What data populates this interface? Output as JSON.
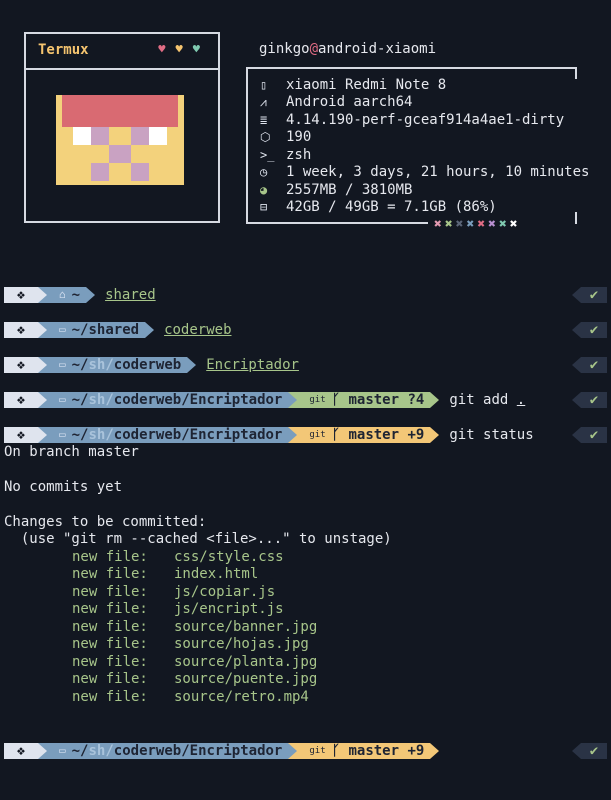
{
  "fetch": {
    "title": "Termux",
    "hearts": [
      "♥",
      "♥",
      "♥"
    ],
    "user": "ginkgo",
    "at": "@",
    "host": "android-xiaomi",
    "rows": [
      {
        "icon": "phone-icon",
        "glyph": "▯",
        "text": "xiaomi Redmi Note 8"
      },
      {
        "icon": "android-icon",
        "glyph": "⩘",
        "text": "Android aarch64"
      },
      {
        "icon": "kernel-icon",
        "glyph": "≣",
        "text": "4.14.190-perf-gceaf914a4ae1-dirty"
      },
      {
        "icon": "package-icon",
        "glyph": "⬡",
        "text": "190"
      },
      {
        "icon": "shell-icon",
        "glyph": ">_",
        "text": "zsh"
      },
      {
        "icon": "clock-icon",
        "glyph": "◷",
        "text": "1 week, 3 days, 21 hours, 10 minutes"
      },
      {
        "icon": "memory-icon",
        "glyph": "◕",
        "text": "2557MB / 3810MB"
      },
      {
        "icon": "disk-icon",
        "glyph": "⊟",
        "text": "42GB / 49GB = 7.1GB (86%)"
      }
    ],
    "palette": [
      {
        "ch": "✖",
        "color": "#e39ab1"
      },
      {
        "ch": "✖",
        "color": "#a7c58a"
      },
      {
        "ch": "✖",
        "color": "#5a6477"
      },
      {
        "ch": "✖",
        "color": "#7a9dbd"
      },
      {
        "ch": "✖",
        "color": "#e06c84"
      },
      {
        "ch": "✖",
        "color": "#b88fd0"
      },
      {
        "ch": "✖",
        "color": "#7fc9b0"
      },
      {
        "ch": "✖",
        "color": "#ffffff"
      }
    ]
  },
  "prompts": [
    {
      "path_pre": "~",
      "path_dim": "",
      "path_bold": "",
      "home_icon": "⌂",
      "git": null,
      "command": "shared",
      "command_style": "underline-green"
    },
    {
      "path_pre": "~/",
      "path_dim": "",
      "path_bold": "shared",
      "home_icon": "▭",
      "git": null,
      "command": "coderweb",
      "command_style": "underline-green"
    },
    {
      "path_pre": "~/",
      "path_dim": "sh/",
      "path_bold": "coderweb",
      "home_icon": "▭",
      "git": null,
      "command": "Encriptador",
      "command_style": "underline-green"
    },
    {
      "path_pre": "~/",
      "path_dim": "sh/",
      "path_bold": "coderweb/Encriptador",
      "home_icon": "▭",
      "git": {
        "label": "git",
        "branch_icon": "ᚴ",
        "branch": "master",
        "status": "?4",
        "color": "green"
      },
      "command": "git add",
      "command_arg": ".",
      "command_style": "white"
    },
    {
      "path_pre": "~/",
      "path_dim": "sh/",
      "path_bold": "coderweb/Encriptador",
      "home_icon": "▭",
      "git": {
        "label": "git",
        "branch_icon": "ᚴ",
        "branch": "master",
        "status": "+9",
        "color": "yellow"
      },
      "command": "git status",
      "command_arg": "",
      "command_style": "white"
    },
    {
      "path_pre": "~/",
      "path_dim": "sh/",
      "path_bold": "coderweb/Encriptador",
      "home_icon": "▭",
      "git": {
        "label": "git",
        "branch_icon": "ᚴ",
        "branch": "master",
        "status": "+9",
        "color": "yellow"
      },
      "command": "",
      "command_arg": "",
      "command_style": "white"
    }
  ],
  "os_icon": "❖",
  "check": "✔",
  "output": {
    "line1": "On branch master",
    "line2": "No commits yet",
    "line3": "Changes to be committed:",
    "line4": "  (use \"git rm --cached <file>...\" to unstage)",
    "new_file_label": "new file:",
    "files": [
      "css/style.css",
      "index.html",
      "js/copiar.js",
      "js/encript.js",
      "source/banner.jpg",
      "source/hojas.jpg",
      "source/planta.jpg",
      "source/puente.jpg",
      "source/retro.mp4"
    ]
  }
}
